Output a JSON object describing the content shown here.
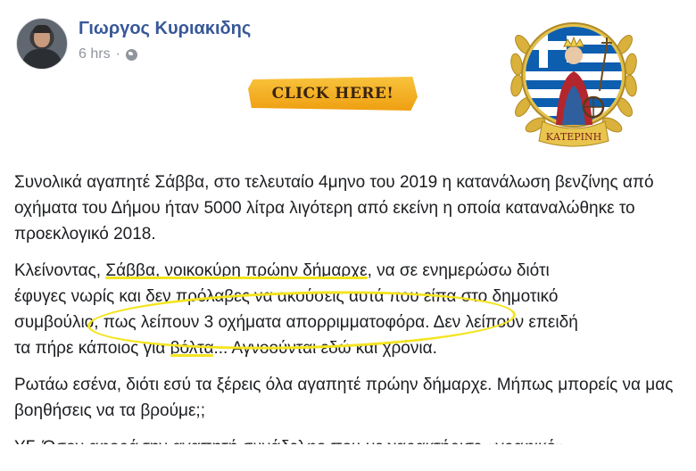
{
  "post": {
    "author": "Γιωργος Κυριακιδης",
    "time": "6 hrs",
    "separator": "·",
    "privacy_icon": "globe-icon",
    "banner_button": "CLICK HERE!",
    "emblem_text": "ΚΑΤΕΡΙΝΗ",
    "paragraph1": "Συνολικά αγαπητέ Σάββα, στο τελευταίο 4μηνο του 2019 η κατανάλωση βενζίνης από οχήματα του Δήμου ήταν 5000 λίτρα λιγότερη από εκείνη η οποία καταναλώθηκε το προεκλογικό 2018.",
    "paragraph2": {
      "intro": "Κλείνοντας, ",
      "highlight": "Σάββα, νοικοκύρη πρώην δήμαρχε",
      "rest_line": ", να σε ενημερώσω διότι",
      "line2": "έφυγες νωρίς και δεν πρόλαβες να ακούσεις αυτά που είπα στο δημοτικό",
      "line3": "συμβούλιο, πως λείπουν 3 οχήματα απορριμματοφόρα. Δεν λείπουν επειδή",
      "line4_a": "τα πήρε κάποιος για ",
      "line4_b": "βόλτα",
      "line4_c": "... Αγνοούνται εδώ και χρόνια."
    },
    "paragraph3": "Ρωτάω εσένα, διότι εσύ τα ξέρεις όλα αγαπητέ πρώην δήμαρχε. Μήπως μπορείς να μας βοηθήσεις να τα βρούμε;;",
    "paragraph4": "ΥΓ. Όσον αφορά την αγαπητή συνάδελφο που με χαρακτήρισε «γραφικό»"
  },
  "colors": {
    "author": "#385898",
    "meta": "#90949c",
    "highlight": "#f4e421",
    "button": "#f2a71b",
    "flag_blue": "#0d5eaf",
    "gold": "#d9b13b"
  }
}
